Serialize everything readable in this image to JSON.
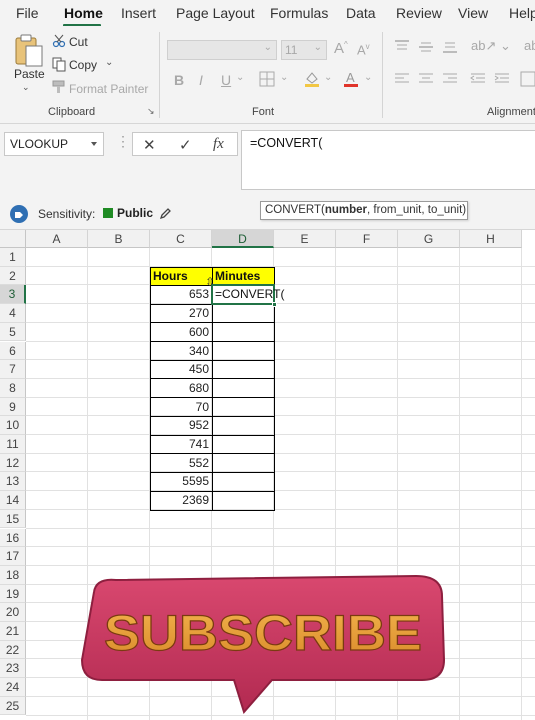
{
  "menu": {
    "tabs": [
      "File",
      "Home",
      "Insert",
      "Page Layout",
      "Formulas",
      "Data",
      "Review",
      "View",
      "Help"
    ],
    "active": "Home"
  },
  "ribbon": {
    "clipboard": {
      "paste": "Paste",
      "cut": "Cut",
      "copy": "Copy",
      "format_painter": "Format Painter",
      "group_label": "Clipboard"
    },
    "font": {
      "font_name": "",
      "font_size": "11",
      "bold": "B",
      "italic": "I",
      "underline": "U",
      "group_label": "Font"
    },
    "alignment": {
      "group_label": "Alignment"
    }
  },
  "formula_bar": {
    "name_box": "VLOOKUP",
    "cancel": "✕",
    "enter": "✓",
    "fx": "fx",
    "formula": "=CONVERT("
  },
  "sensitivity": {
    "label": "Sensitivity:",
    "value": "Public",
    "tag_color": "#1f8b24"
  },
  "tooltip": {
    "func": "CONVERT(",
    "arg_bold": "number",
    "rest": ", from_unit, to_unit)"
  },
  "grid": {
    "columns": [
      "A",
      "B",
      "C",
      "D",
      "E",
      "F",
      "G",
      "H"
    ],
    "rows": [
      "1",
      "2",
      "3",
      "4",
      "5",
      "6",
      "7",
      "8",
      "9",
      "10",
      "11",
      "12",
      "13",
      "14",
      "15",
      "16",
      "17",
      "18",
      "19",
      "20",
      "21",
      "22",
      "23",
      "24",
      "25"
    ],
    "selected_column": "D",
    "selected_row": "3",
    "header_hours": "Hours",
    "header_minutes": "Minutes",
    "hours": [
      "653",
      "270",
      "600",
      "340",
      "450",
      "680",
      "70",
      "952",
      "741",
      "552",
      "5595",
      "2369"
    ],
    "active_cell_text": "=CONVERT("
  },
  "overlay": {
    "subscribe": "SUBSCRIBE"
  },
  "colors": {
    "accent": "#217346",
    "header_fill": "#ffff00",
    "subscribe_bg": "#c9385f",
    "subscribe_text": "#e8a037"
  }
}
